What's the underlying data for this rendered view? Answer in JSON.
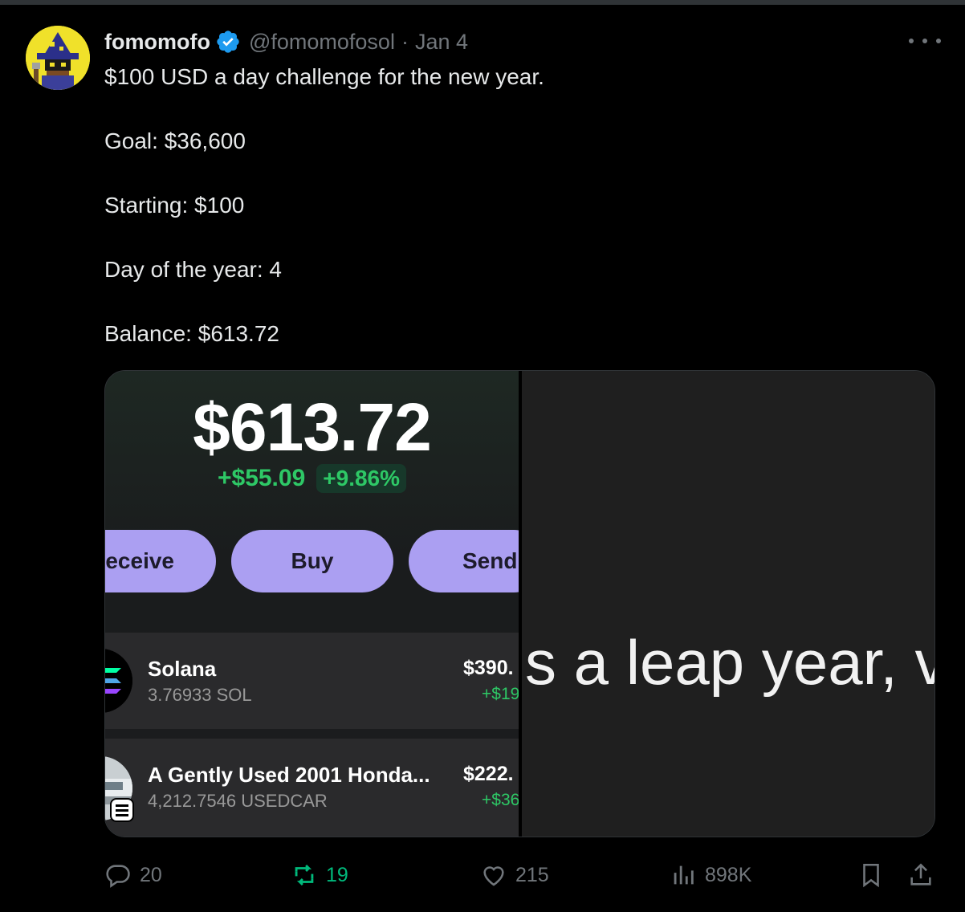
{
  "author": {
    "display_name": "fomomofo",
    "handle": "@fomomofosol",
    "separator": "·",
    "date": "Jan 4"
  },
  "tweet": {
    "lines": [
      "$100 USD a day challenge for the new year.",
      "Goal: $36,600",
      "Starting: $100",
      "Day of the year: 4",
      "Balance: $613.72"
    ]
  },
  "media": {
    "wallet": {
      "balance": "$613.72",
      "change": "+$55.09",
      "change_pct": "+9.86%",
      "buttons": [
        "Receive",
        "Buy",
        "Send"
      ],
      "tokens": [
        {
          "name": "Solana",
          "amount": "3.76933 SOL",
          "value": "$390.",
          "delta": "+$19"
        },
        {
          "name": "A Gently Used 2001 Honda...",
          "amount": "4,212.7546 USEDCAR",
          "value": "$222.",
          "delta": "+$36"
        }
      ]
    },
    "caption_fragment": "s a leap year, v"
  },
  "actions": {
    "replies": "20",
    "reposts": "19",
    "likes": "215",
    "views": "898K"
  },
  "colors": {
    "verified": "#1d9bf0",
    "repost_active": "#00ba7c",
    "muted": "#71767b",
    "wallet_accent": "#ab9ff2",
    "gain": "#2ec866"
  }
}
